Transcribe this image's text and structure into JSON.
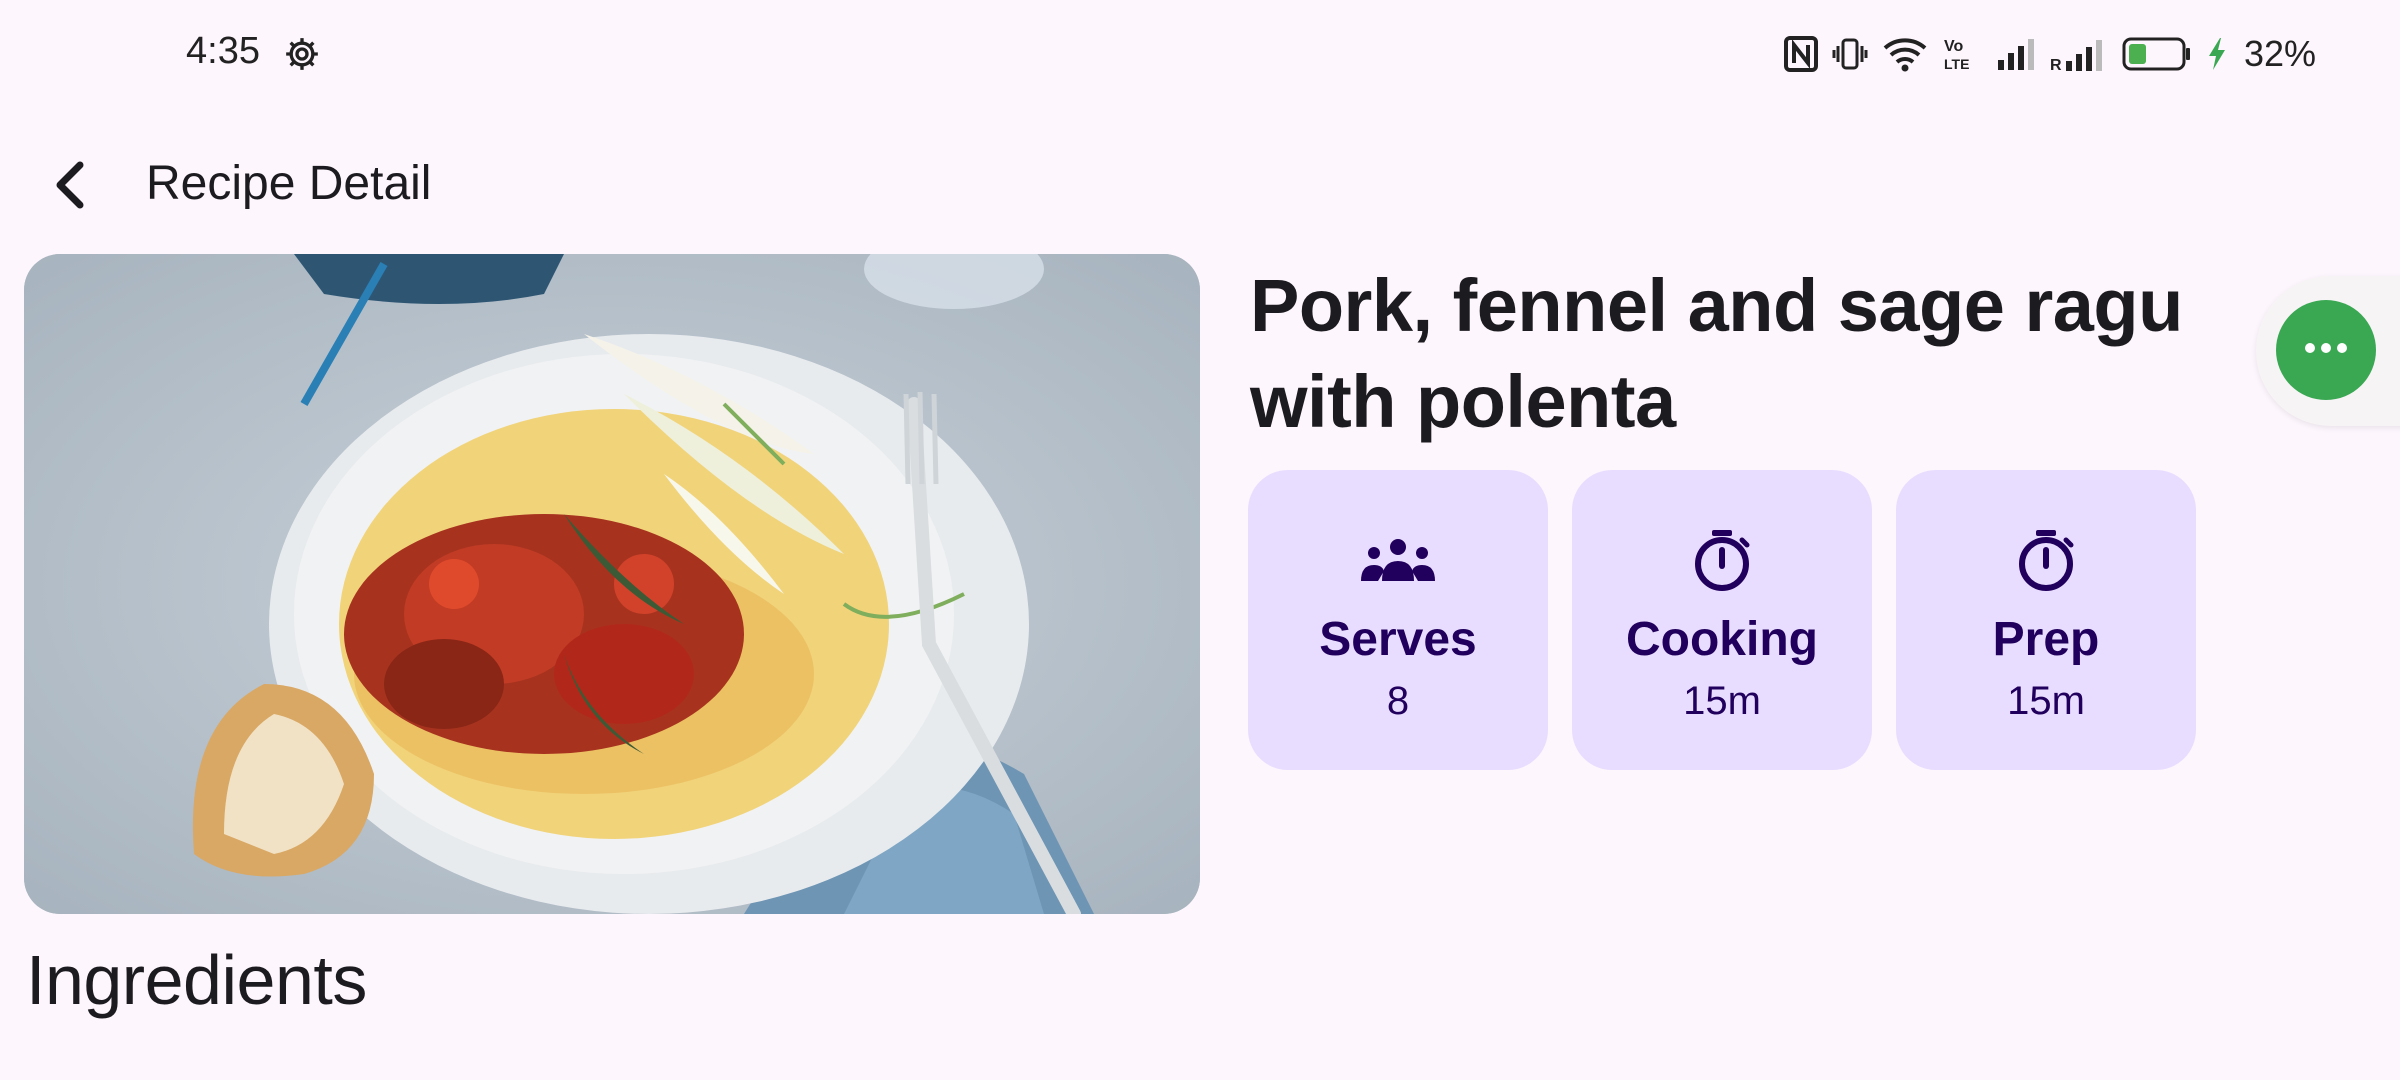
{
  "status_bar": {
    "time": "4:35",
    "battery_percent": "32%",
    "icons": [
      "settings-gear-icon",
      "nfc-icon",
      "vibrate-icon",
      "wifi-icon",
      "volte-icon",
      "signal-icon",
      "roaming-signal-icon",
      "battery-icon",
      "charging-bolt-icon"
    ]
  },
  "app_bar": {
    "title": "Recipe Detail",
    "back_icon": "chevron-left-icon"
  },
  "recipe": {
    "title": "Pork, fennel and sage ragu with polenta",
    "image_alt": "polenta-ragu-photo"
  },
  "stats": [
    {
      "label": "Serves",
      "value": "8",
      "icon": "group-icon"
    },
    {
      "label": "Cooking",
      "value": "15m",
      "icon": "timer-icon"
    },
    {
      "label": "Prep",
      "value": "15m",
      "icon": "timer-icon"
    }
  ],
  "fab": {
    "icon": "more-horizontal-icon"
  },
  "sections": {
    "ingredients_heading": "Ingredients"
  },
  "colors": {
    "background": "#fdf6fd",
    "card": "#e9ddff",
    "card_text": "#21005d",
    "fab": "#3aa853",
    "battery_fill": "#4caf50"
  }
}
